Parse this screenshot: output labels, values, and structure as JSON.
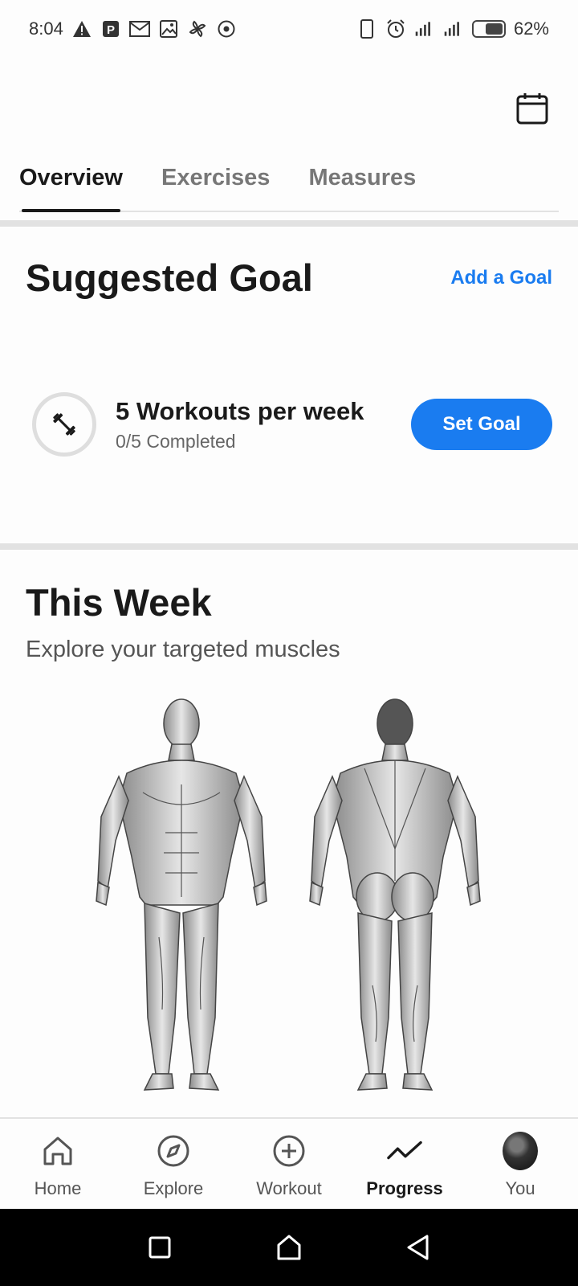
{
  "status_bar": {
    "time": "8:04",
    "battery_percent": "62%",
    "battery_level": 0.62,
    "left_icons": [
      "warning-icon",
      "parking-icon",
      "mail-icon",
      "gallery-icon",
      "pinwheel-icon",
      "target-icon"
    ],
    "right_icons": [
      "phone-icon",
      "alarm-icon",
      "signal-icon",
      "signal-icon",
      "battery-icon"
    ]
  },
  "header": {
    "calendar_icon": "calendar-icon"
  },
  "tabs": [
    {
      "label": "Overview",
      "active": true
    },
    {
      "label": "Exercises",
      "active": false
    },
    {
      "label": "Measures",
      "active": false
    }
  ],
  "goal": {
    "title": "Suggested Goal",
    "add_label": "Add a Goal",
    "name": "5 Workouts per week",
    "progress": "0/5 Completed",
    "completed": 0,
    "target": 5,
    "button_label": "Set Goal",
    "icon": "dumbbell-icon"
  },
  "week": {
    "title": "This Week",
    "subtitle": "Explore your targeted muscles"
  },
  "nav": [
    {
      "label": "Home",
      "icon": "home-icon",
      "active": false
    },
    {
      "label": "Explore",
      "icon": "compass-icon",
      "active": false
    },
    {
      "label": "Workout",
      "icon": "plus-circle-icon",
      "active": false
    },
    {
      "label": "Progress",
      "icon": "trend-icon",
      "active": true
    },
    {
      "label": "You",
      "icon": "avatar",
      "active": false
    }
  ],
  "colors": {
    "accent": "#1a7cf0",
    "text": "#1a1a1a",
    "muted": "#666666",
    "divider": "#e2e2e2"
  }
}
